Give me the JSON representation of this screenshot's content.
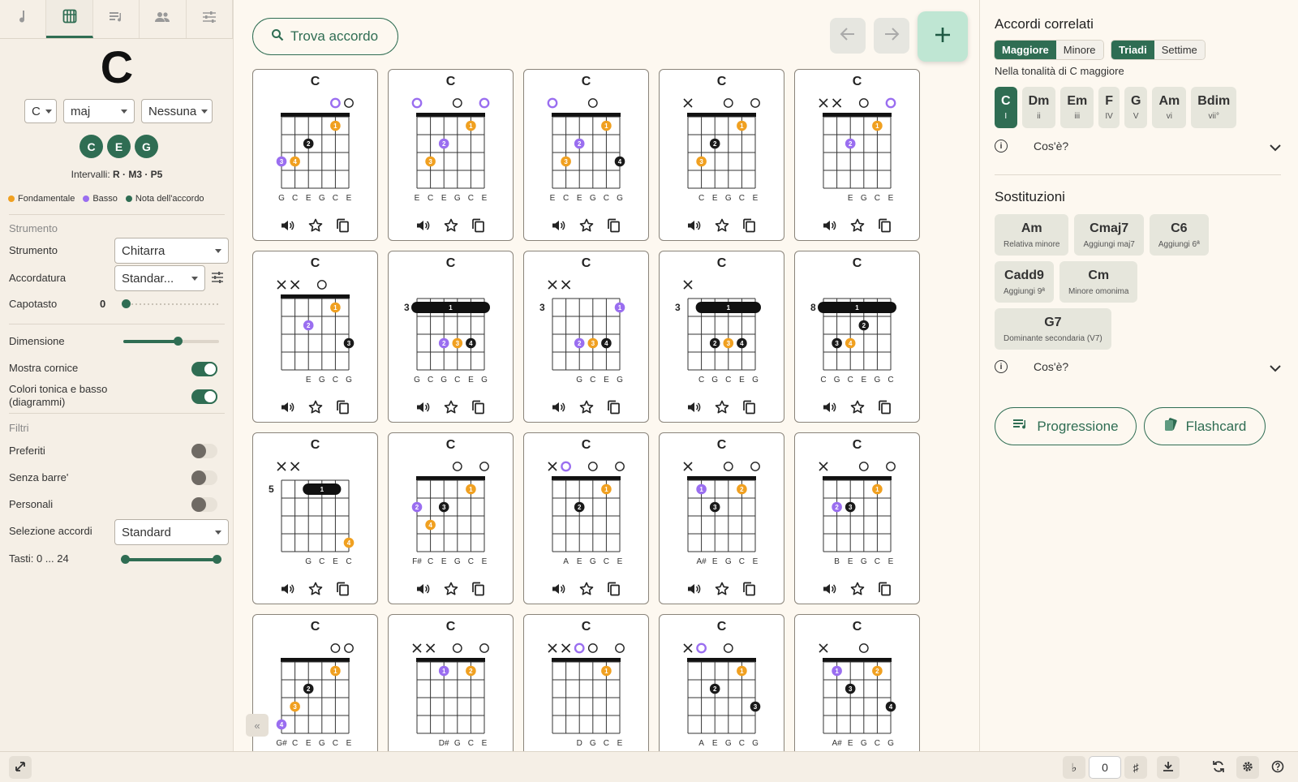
{
  "left_panel": {
    "tabs": [
      {
        "icon": "music-note-icon",
        "active": false
      },
      {
        "icon": "guitar-chord-icon",
        "active": true
      },
      {
        "icon": "playlist-icon",
        "active": false
      },
      {
        "icon": "people-icon",
        "active": false
      },
      {
        "icon": "sliders-icon",
        "active": false
      }
    ],
    "chord_name": "C",
    "root_select": "C",
    "quality_select": "maj",
    "bass_select": "Nessuna",
    "notes": [
      "C",
      "E",
      "G"
    ],
    "intervals_label": "Intervalli:",
    "intervals_value": "R · M3 · P5",
    "legend": [
      {
        "label": "Fondamentale",
        "color": "#f0a020"
      },
      {
        "label": "Basso",
        "color": "#9a6ef0"
      },
      {
        "label": "Nota dell'accordo",
        "color": "#2f6d53"
      }
    ],
    "instrument_section": "Strumento",
    "instrument_label": "Strumento",
    "instrument_value": "Chitarra",
    "tuning_label": "Accordatura",
    "tuning_value": "Standar...",
    "capo_label": "Capotasto",
    "capo_value": "0",
    "size_label": "Dimensione",
    "size_fraction": 0.57,
    "frame_label": "Mostra cornice",
    "frame_on": true,
    "colors_label": "Colori tonica e basso (diagrammi)",
    "colors_on": true,
    "filters_section": "Filtri",
    "favorites_label": "Preferiti",
    "favorites_on": false,
    "nobarre_label": "Senza barre'",
    "nobarre_on": false,
    "custom_label": "Personali",
    "custom_on": false,
    "selection_label": "Selezione accordi",
    "selection_value": "Standard",
    "frets_label": "Tasti: 0 ... 24",
    "frets_range": [
      0,
      24
    ]
  },
  "toolbar": {
    "find_label": "Trova accordo"
  },
  "chords": [
    {
      "name": "C",
      "markers": [
        "",
        "",
        "",
        "",
        "r",
        "o"
      ],
      "start": 1,
      "barre": null,
      "dots": [
        [
          5,
          1,
          1,
          "root"
        ],
        [
          3,
          2,
          2,
          "note"
        ],
        [
          1,
          3,
          3,
          "bass"
        ],
        [
          2,
          3,
          4,
          "root"
        ]
      ],
      "notes": [
        "G",
        "C",
        "E",
        "G",
        "C",
        "E"
      ]
    },
    {
      "name": "C",
      "markers": [
        "r",
        "",
        "",
        "o",
        "",
        "r"
      ],
      "start": 1,
      "barre": null,
      "dots": [
        [
          5,
          1,
          1,
          "root"
        ],
        [
          3,
          2,
          2,
          "bass"
        ],
        [
          2,
          3,
          3,
          "root"
        ]
      ],
      "notes": [
        "E",
        "C",
        "E",
        "G",
        "C",
        "E"
      ]
    },
    {
      "name": "C",
      "markers": [
        "r",
        "",
        "",
        "o",
        "",
        ""
      ],
      "start": 1,
      "barre": null,
      "dots": [
        [
          5,
          1,
          1,
          "root"
        ],
        [
          3,
          2,
          2,
          "bass"
        ],
        [
          2,
          3,
          3,
          "root"
        ],
        [
          6,
          3,
          4,
          "note"
        ]
      ],
      "notes": [
        "E",
        "C",
        "E",
        "G",
        "C",
        "G"
      ]
    },
    {
      "name": "C",
      "markers": [
        "x",
        "",
        "",
        "o",
        "",
        "o"
      ],
      "start": 1,
      "barre": null,
      "dots": [
        [
          5,
          1,
          1,
          "root"
        ],
        [
          3,
          2,
          2,
          "note"
        ],
        [
          2,
          3,
          3,
          "root"
        ]
      ],
      "notes": [
        "",
        "C",
        "E",
        "G",
        "C",
        "E"
      ]
    },
    {
      "name": "C",
      "markers": [
        "x",
        "x",
        "",
        "o",
        "",
        "r"
      ],
      "start": 1,
      "barre": null,
      "dots": [
        [
          5,
          1,
          1,
          "root"
        ],
        [
          3,
          2,
          2,
          "bass"
        ]
      ],
      "notes": [
        "",
        "",
        "E",
        "G",
        "C",
        "E"
      ]
    },
    {
      "name": "C",
      "markers": [
        "x",
        "x",
        "",
        "o",
        "",
        ""
      ],
      "start": 1,
      "barre": null,
      "dots": [
        [
          5,
          1,
          1,
          "root"
        ],
        [
          3,
          2,
          2,
          "bass"
        ],
        [
          6,
          3,
          3,
          "note"
        ]
      ],
      "notes": [
        "",
        "",
        "E",
        "G",
        "C",
        "G"
      ]
    },
    {
      "name": "C",
      "markers": [
        "",
        "",
        "",
        "",
        "",
        ""
      ],
      "start": 3,
      "barre": [
        1,
        1,
        6
      ],
      "dots": [
        [
          3,
          3,
          2,
          "bass"
        ],
        [
          4,
          3,
          3,
          "root"
        ],
        [
          5,
          3,
          4,
          "note"
        ]
      ],
      "notes": [
        "G",
        "C",
        "G",
        "C",
        "E",
        "G"
      ]
    },
    {
      "name": "C",
      "markers": [
        "x",
        "x",
        "",
        "",
        "",
        ""
      ],
      "start": 3,
      "barre": null,
      "dots": [
        [
          6,
          1,
          1,
          "bass"
        ],
        [
          3,
          3,
          2,
          "bass"
        ],
        [
          4,
          3,
          3,
          "root"
        ],
        [
          5,
          3,
          4,
          "note"
        ]
      ],
      "notes": [
        "",
        "",
        "G",
        "C",
        "E",
        "G"
      ]
    },
    {
      "name": "C",
      "markers": [
        "x",
        "",
        "",
        "",
        "",
        ""
      ],
      "start": 3,
      "barre": [
        1,
        2,
        6
      ],
      "dots": [
        [
          3,
          3,
          2,
          "note"
        ],
        [
          4,
          3,
          3,
          "root"
        ],
        [
          5,
          3,
          4,
          "note"
        ]
      ],
      "notes": [
        "",
        "C",
        "G",
        "C",
        "E",
        "G"
      ]
    },
    {
      "name": "C",
      "markers": [
        "",
        "",
        "",
        "",
        "",
        ""
      ],
      "start": 8,
      "barre": [
        1,
        1,
        6
      ],
      "dots": [
        [
          4,
          2,
          2,
          "note"
        ],
        [
          2,
          3,
          3,
          "note"
        ],
        [
          3,
          3,
          4,
          "root"
        ]
      ],
      "notes": [
        "C",
        "G",
        "C",
        "E",
        "G",
        "C"
      ]
    },
    {
      "name": "C",
      "markers": [
        "x",
        "x",
        "",
        "",
        "",
        ""
      ],
      "start": 5,
      "barre": [
        1,
        3,
        5
      ],
      "dots": [
        [
          6,
          4,
          4,
          "root"
        ]
      ],
      "notes": [
        "",
        "",
        "G",
        "C",
        "E",
        "C"
      ]
    },
    {
      "name": "C",
      "markers": [
        "",
        "",
        "",
        "o",
        "",
        "o"
      ],
      "start": 1,
      "barre": null,
      "dots": [
        [
          5,
          1,
          1,
          "root"
        ],
        [
          1,
          2,
          2,
          "bass"
        ],
        [
          3,
          2,
          3,
          "note"
        ],
        [
          2,
          3,
          4,
          "root"
        ]
      ],
      "notes": [
        "F#",
        "C",
        "E",
        "G",
        "C",
        "E"
      ]
    },
    {
      "name": "C",
      "markers": [
        "x",
        "r",
        "",
        "o",
        "",
        "o"
      ],
      "start": 1,
      "barre": null,
      "dots": [
        [
          5,
          1,
          1,
          "root"
        ],
        [
          3,
          2,
          2,
          "note"
        ]
      ],
      "notes": [
        "",
        "A",
        "E",
        "G",
        "C",
        "E"
      ]
    },
    {
      "name": "C",
      "markers": [
        "x",
        "",
        "",
        "o",
        "",
        "o"
      ],
      "start": 1,
      "barre": null,
      "dots": [
        [
          2,
          1,
          1,
          "bass"
        ],
        [
          5,
          1,
          2,
          "root"
        ],
        [
          3,
          2,
          3,
          "note"
        ]
      ],
      "notes": [
        "",
        "A#",
        "E",
        "G",
        "C",
        "E"
      ]
    },
    {
      "name": "C",
      "markers": [
        "x",
        "",
        "",
        "o",
        "",
        "o"
      ],
      "start": 1,
      "barre": null,
      "dots": [
        [
          5,
          1,
          1,
          "root"
        ],
        [
          2,
          2,
          2,
          "bass"
        ],
        [
          3,
          2,
          3,
          "note"
        ]
      ],
      "notes": [
        "",
        "B",
        "E",
        "G",
        "C",
        "E"
      ]
    },
    {
      "name": "C",
      "markers": [
        "",
        "",
        "",
        "",
        "o",
        "o"
      ],
      "start": 1,
      "barre": null,
      "dots": [
        [
          5,
          1,
          1,
          "root"
        ],
        [
          3,
          2,
          2,
          "note"
        ],
        [
          2,
          3,
          3,
          "root"
        ],
        [
          1,
          4,
          4,
          "bass"
        ]
      ],
      "notes": [
        "G#",
        "C",
        "E",
        "G",
        "C",
        "E"
      ]
    },
    {
      "name": "C",
      "markers": [
        "x",
        "x",
        "",
        "o",
        "",
        "o"
      ],
      "start": 1,
      "barre": null,
      "dots": [
        [
          3,
          1,
          1,
          "bass"
        ],
        [
          5,
          1,
          2,
          "root"
        ]
      ],
      "notes": [
        "",
        "",
        "D#",
        "G",
        "C",
        "E"
      ]
    },
    {
      "name": "C",
      "markers": [
        "x",
        "x",
        "r",
        "o",
        "",
        "o"
      ],
      "start": 1,
      "barre": null,
      "dots": [
        [
          5,
          1,
          1,
          "root"
        ]
      ],
      "notes": [
        "",
        "",
        "D",
        "G",
        "C",
        "E"
      ]
    },
    {
      "name": "C",
      "markers": [
        "x",
        "r",
        "",
        "o",
        "",
        ""
      ],
      "start": 1,
      "barre": null,
      "dots": [
        [
          5,
          1,
          1,
          "root"
        ],
        [
          3,
          2,
          2,
          "note"
        ],
        [
          6,
          3,
          3,
          "note"
        ]
      ],
      "notes": [
        "",
        "A",
        "E",
        "G",
        "C",
        "G"
      ]
    },
    {
      "name": "C",
      "markers": [
        "x",
        "",
        "",
        "o",
        "",
        ""
      ],
      "start": 1,
      "barre": null,
      "dots": [
        [
          2,
          1,
          1,
          "bass"
        ],
        [
          5,
          1,
          2,
          "root"
        ],
        [
          3,
          2,
          3,
          "note"
        ],
        [
          6,
          3,
          4,
          "note"
        ]
      ],
      "notes": [
        "",
        "A#",
        "E",
        "G",
        "C",
        "G"
      ]
    }
  ],
  "right_panel": {
    "related_title": "Accordi correlati",
    "quality_tabs": [
      {
        "label": "Maggiore",
        "active": true
      },
      {
        "label": "Minore",
        "active": false
      }
    ],
    "type_tabs": [
      {
        "label": "Triadi",
        "active": true
      },
      {
        "label": "Settime",
        "active": false
      }
    ],
    "key_subtitle": "Nella tonalità di C maggiore",
    "degrees": [
      {
        "chord": "C",
        "roman": "I",
        "active": true
      },
      {
        "chord": "Dm",
        "roman": "ii",
        "active": false
      },
      {
        "chord": "Em",
        "roman": "iii",
        "active": false
      },
      {
        "chord": "F",
        "roman": "IV",
        "active": false
      },
      {
        "chord": "G",
        "roman": "V",
        "active": false
      },
      {
        "chord": "Am",
        "roman": "vi",
        "active": false
      },
      {
        "chord": "Bdim",
        "roman": "vii°",
        "active": false
      }
    ],
    "whats_this_1": "Cos'è?",
    "subs_title": "Sostituzioni",
    "substitutions_row1": [
      {
        "chord": "Am",
        "desc": "Relativa minore"
      },
      {
        "chord": "Cmaj7",
        "desc": "Aggiungi maj7"
      },
      {
        "chord": "C6",
        "desc": "Aggiungi 6ª"
      }
    ],
    "substitutions_row2": [
      {
        "chord": "Cadd9",
        "desc": "Aggiungi 9ª"
      },
      {
        "chord": "Cm",
        "desc": "Minore omonima"
      }
    ],
    "substitutions_row3": [
      {
        "chord": "G7",
        "desc": "Dominante secondaria (V7)"
      }
    ],
    "whats_this_2": "Cos'è?",
    "progression_label": "Progressione",
    "flashcard_label": "Flashcard"
  },
  "footer": {
    "flat_label": "♭",
    "transpose_value": "0",
    "sharp_label": "♯"
  },
  "colors": {
    "accent": "#2f6d53",
    "root": "#f0a020",
    "bass": "#9a6ef0",
    "note": "#1a1a1a",
    "bg": "#fdf8f0"
  }
}
